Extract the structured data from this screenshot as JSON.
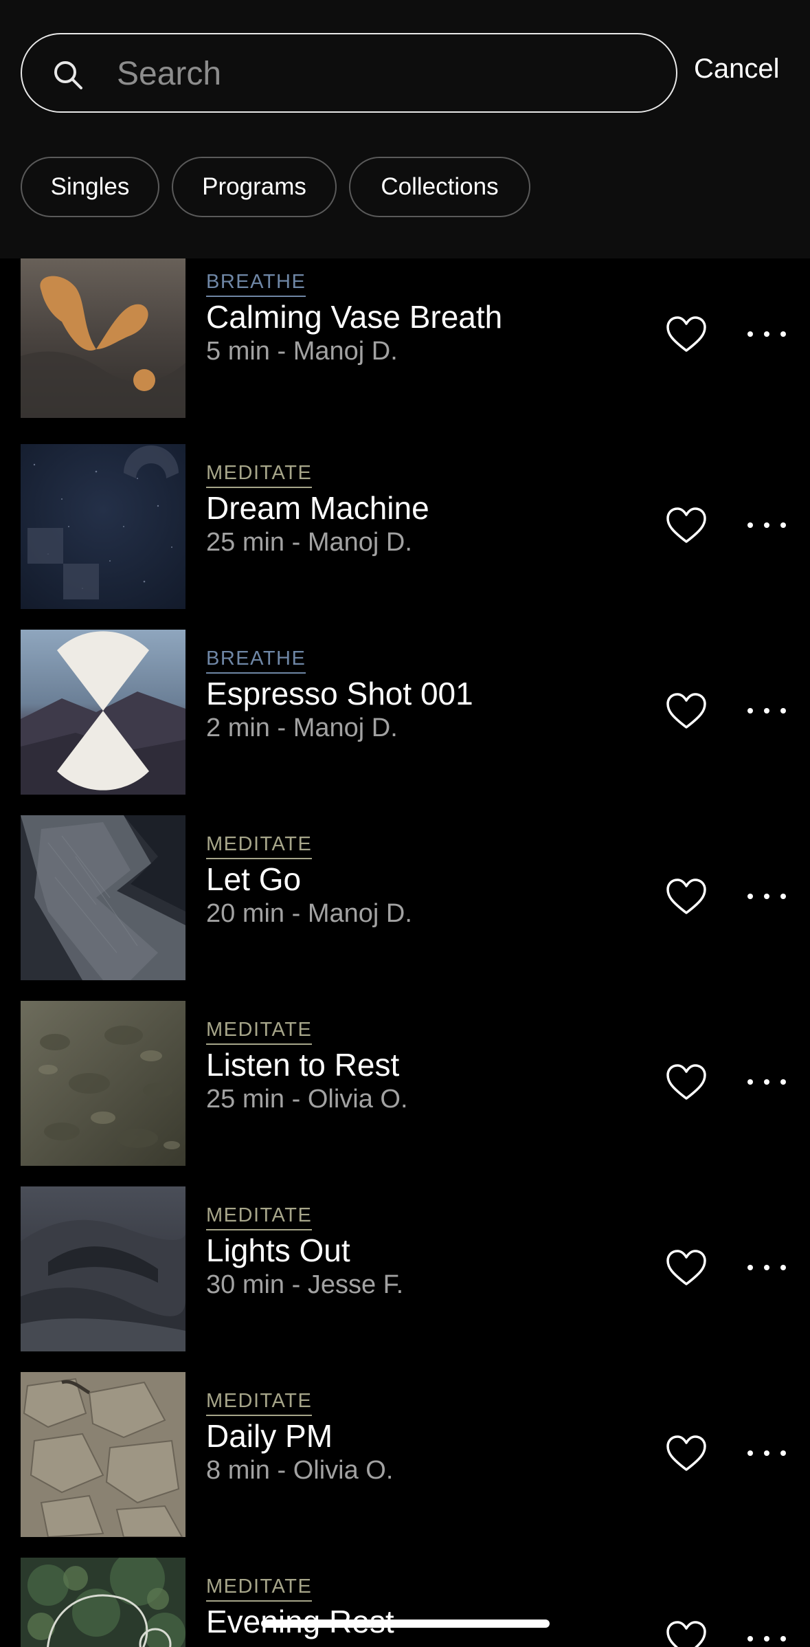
{
  "search": {
    "placeholder": "Search",
    "cancel_label": "Cancel"
  },
  "filters": [
    "Singles",
    "Programs",
    "Collections"
  ],
  "items": [
    {
      "category": "BREATHE",
      "title": "Calming Vase Breath",
      "meta": "5 min - Manoj D."
    },
    {
      "category": "MEDITATE",
      "title": "Dream Machine",
      "meta": "25 min - Manoj D."
    },
    {
      "category": "BREATHE",
      "title": "Espresso Shot 001",
      "meta": "2 min - Manoj D."
    },
    {
      "category": "MEDITATE",
      "title": "Let Go",
      "meta": "20 min - Manoj D."
    },
    {
      "category": "MEDITATE",
      "title": "Listen to Rest",
      "meta": "25 min - Olivia O."
    },
    {
      "category": "MEDITATE",
      "title": "Lights Out",
      "meta": "30 min - Jesse F."
    },
    {
      "category": "MEDITATE",
      "title": "Daily PM",
      "meta": "8 min - Olivia O."
    },
    {
      "category": "MEDITATE",
      "title": "Evening Rest",
      "meta": ""
    }
  ],
  "icons": {
    "search": "search-icon",
    "favorite": "heart-outline-icon",
    "more": "more-horizontal-icon"
  },
  "colors": {
    "background": "#000000",
    "header_background": "#0d0d0d",
    "breathe_accent": "#6f87a6",
    "meditate_accent": "#a7a68a",
    "secondary_text": "#a2a2a2"
  }
}
